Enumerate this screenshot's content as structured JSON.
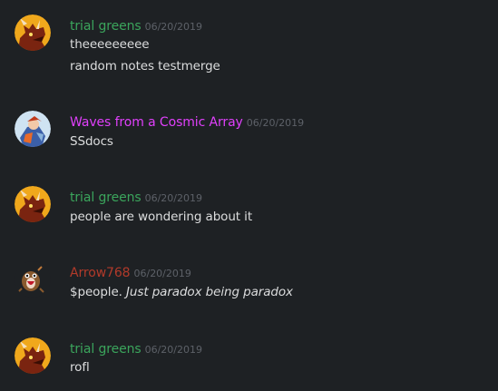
{
  "colors": {
    "background": "#1e2124",
    "trial_greens": "#3ba55c",
    "waves": "#e040fb",
    "arrow": "#b23a2a",
    "timestamp": "#5d6168",
    "text": "#dcddde"
  },
  "messages": [
    {
      "author": "trial greens",
      "avatar_icon": "dragon-avatar-icon",
      "timestamp": "06/20/2019",
      "lines": [
        "theeeeeeeee",
        "random notes testmerge"
      ]
    },
    {
      "author": "Waves from a Cosmic Array",
      "avatar_icon": "anime-character-avatar-icon",
      "timestamp": "06/20/2019",
      "lines": [
        "SSdocs"
      ]
    },
    {
      "author": "trial greens",
      "avatar_icon": "dragon-avatar-icon",
      "timestamp": "06/20/2019",
      "lines": [
        "people are wondering about it"
      ]
    },
    {
      "author": "Arrow768",
      "avatar_icon": "creature-avatar-icon",
      "timestamp": "06/20/2019",
      "lines": [
        {
          "plain": "$people. ",
          "italic": "Just paradox being paradox"
        }
      ]
    },
    {
      "author": "trial greens",
      "avatar_icon": "dragon-avatar-icon",
      "timestamp": "06/20/2019",
      "lines": [
        "rofl"
      ]
    }
  ]
}
